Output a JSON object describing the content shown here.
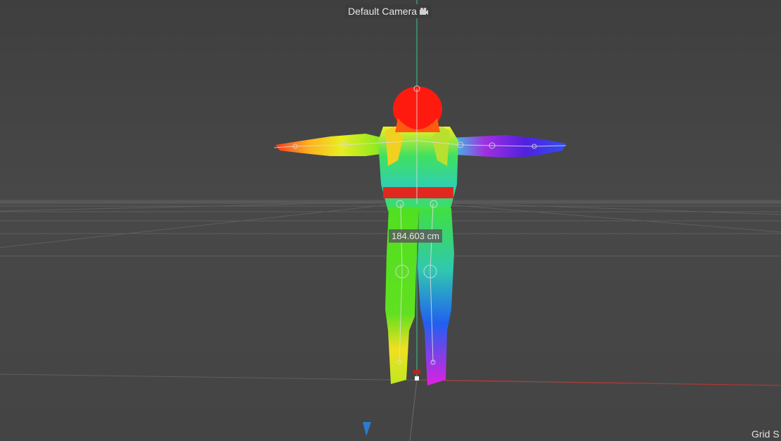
{
  "viewport": {
    "camera_label": "Default Camera",
    "measurement": "184.603 cm",
    "grid_label": "Grid S"
  },
  "colors": {
    "background": "#4a4a4a",
    "grid": "#5e5e5e",
    "axis_x": "#c03030",
    "axis_y": "#3ec38a"
  },
  "icons": {
    "camera": "camera-icon",
    "axis_pointer": "axis-pointer-icon"
  }
}
